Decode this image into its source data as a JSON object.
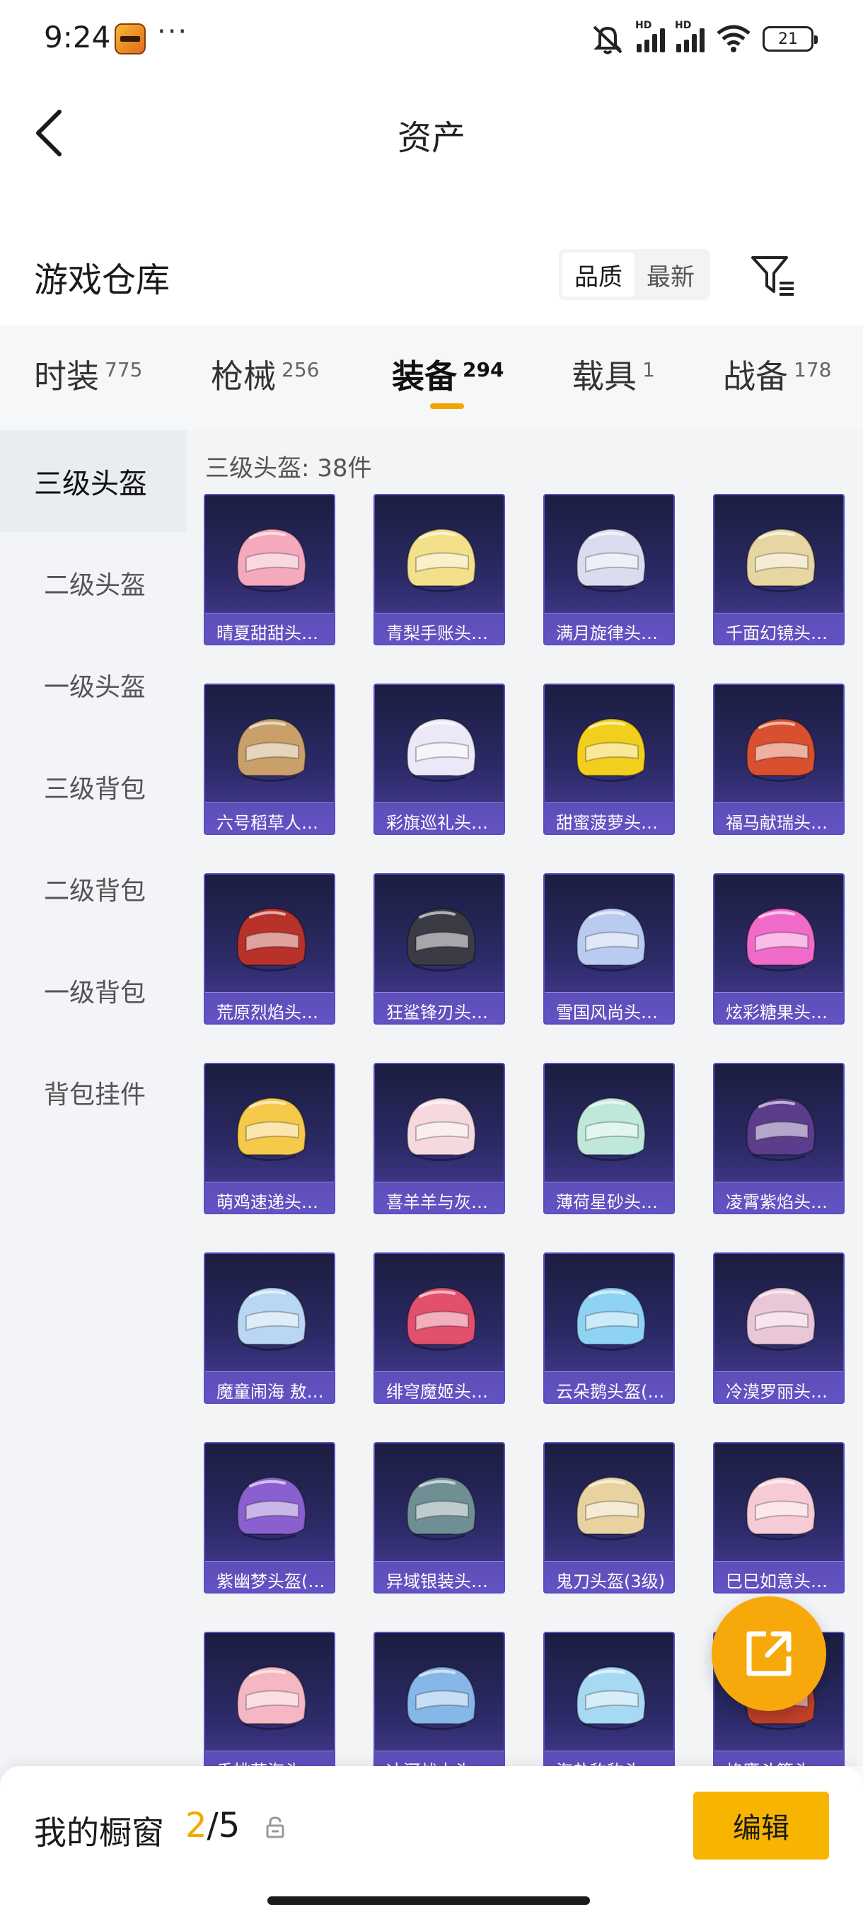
{
  "status_bar": {
    "time": "9:24",
    "dots": "···",
    "battery": "21"
  },
  "header": {
    "title": "资产"
  },
  "warehouse": {
    "title": "游戏仓库",
    "sort_options": [
      "品质",
      "最新"
    ],
    "active_sort": "品质"
  },
  "tabs": [
    {
      "label": "时装",
      "count": "775"
    },
    {
      "label": "枪械",
      "count": "256"
    },
    {
      "label": "装备",
      "count": "294"
    },
    {
      "label": "载具",
      "count": "1"
    },
    {
      "label": "战备",
      "count": "178"
    }
  ],
  "active_tab": "装备",
  "sidebar": {
    "items": [
      "三级头盔",
      "二级头盔",
      "一级头盔",
      "三级背包",
      "二级背包",
      "一级背包",
      "背包挂件"
    ],
    "active": "三级头盔"
  },
  "section": {
    "label": "三级头盔: 38件"
  },
  "items": [
    {
      "name": "晴夏甜甜头…",
      "color": "#f4a9bd"
    },
    {
      "name": "青梨手账头…",
      "color": "#f3e08a"
    },
    {
      "name": "满月旋律头…",
      "color": "#dcdcf0"
    },
    {
      "name": "千面幻镜头…",
      "color": "#e8d6a2"
    },
    {
      "name": "六号稻草人…",
      "color": "#c9a06a"
    },
    {
      "name": "彩旗巡礼头…",
      "color": "#ece8f8"
    },
    {
      "name": "甜蜜菠萝头…",
      "color": "#f2cf1c"
    },
    {
      "name": "福马献瑞头…",
      "color": "#d9502f"
    },
    {
      "name": "荒原烈焰头…",
      "color": "#b8322a"
    },
    {
      "name": "狂鲨锋刃头…",
      "color": "#3b3b46"
    },
    {
      "name": "雪国风尚头…",
      "color": "#b9cbf0"
    },
    {
      "name": "炫彩糖果头…",
      "color": "#f06ac9"
    },
    {
      "name": "萌鸡速递头…",
      "color": "#f5c94a"
    },
    {
      "name": "喜羊羊与灰…",
      "color": "#f5d9df"
    },
    {
      "name": "薄荷星砂头…",
      "color": "#bfe8db"
    },
    {
      "name": "凌霄紫焰头…",
      "color": "#5b3d8c"
    },
    {
      "name": "魔童闹海 敖…",
      "color": "#b9d7f2"
    },
    {
      "name": "绯穹魔姬头…",
      "color": "#e2506e"
    },
    {
      "name": "云朵鹅头盔(…",
      "color": "#8fd3f4"
    },
    {
      "name": "冷漠罗丽头…",
      "color": "#e9c6d8"
    },
    {
      "name": "紫幽梦头盔(…",
      "color": "#8a5fd0"
    },
    {
      "name": "异域银装头…",
      "color": "#6f8f95"
    },
    {
      "name": "鬼刀头盔(3级)",
      "color": "#e8d3a0"
    },
    {
      "name": "巳巳如意头…",
      "color": "#f7cbd5"
    },
    {
      "name": "香桃花海头…",
      "color": "#f6b7c4"
    },
    {
      "name": "冰河战士头…",
      "color": "#86b7e8"
    },
    {
      "name": "海盐豹豹头…",
      "color": "#a7d9f2"
    },
    {
      "name": "焰鹰斗篷头…",
      "color": "#c2402a"
    }
  ],
  "bottom": {
    "window_label": "我的橱窗",
    "current": "2",
    "total": "/5",
    "edit_label": "编辑"
  },
  "colors": {
    "accent": "#f7b400",
    "card_bg": "#2b2a66",
    "card_border": "#5a4cc0"
  }
}
